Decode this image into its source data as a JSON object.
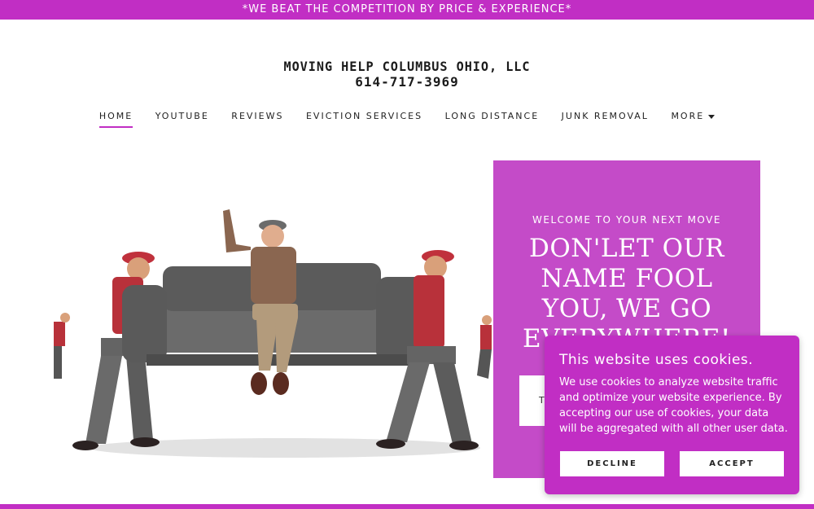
{
  "announcement": "*WE BEAT THE COMPETITION BY PRICE & EXPERIENCE*",
  "brand": {
    "name": "MOVING HELP COLUMBUS OHIO, LLC",
    "phone": "614-717-3969"
  },
  "nav": {
    "items": [
      {
        "label": "HOME",
        "active": true
      },
      {
        "label": "YOUTUBE"
      },
      {
        "label": "REVIEWS"
      },
      {
        "label": "EVICTION SERVICES"
      },
      {
        "label": "LONG DISTANCE"
      },
      {
        "label": "JUNK REMOVAL"
      },
      {
        "label": "MORE"
      }
    ]
  },
  "hero": {
    "kicker": "WELCOME TO YOUR NEXT MOVE",
    "headline": "DON'LET OUR NAME FOOL YOU, WE GO EVERYWHERE!",
    "cta": "T"
  },
  "cookie": {
    "title": "This website uses cookies.",
    "body": "We use cookies to analyze website traffic and optimize your website experience. By accepting our use of cookies, your data will be aggregated with all other user data.",
    "decline": "DECLINE",
    "accept": "ACCEPT"
  },
  "colors": {
    "accent": "#c12ec4",
    "panel": "#c44bc8"
  }
}
